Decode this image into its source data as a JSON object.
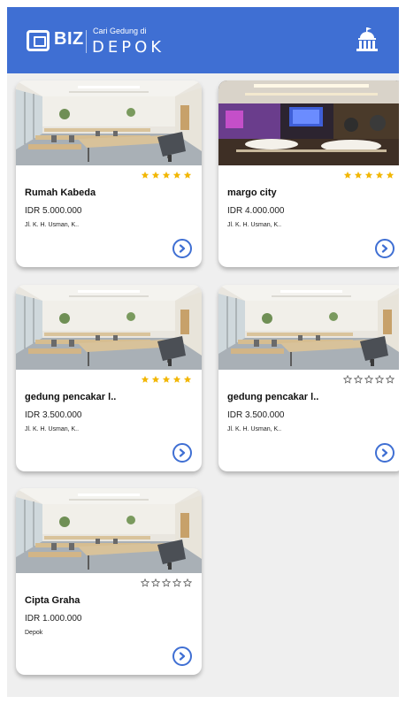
{
  "header": {
    "logo_text": "BIZ",
    "tagline": "Cari Gedung di",
    "city": "DEPOK",
    "building_icon": "building-icon"
  },
  "colors": {
    "primary": "#3f6fd3",
    "star_filled": "#f2b705",
    "star_empty": "#666666",
    "background": "#efefef"
  },
  "venues": [
    {
      "name": "Rumah Kabeda",
      "price": "IDR 5.000.000",
      "address": "Jl. K. H. Usman, K..",
      "rating": 5,
      "photo": "meeting-room"
    },
    {
      "name": "margo city",
      "price": "IDR 4.000.000",
      "address": "Jl. K. H. Usman, K..",
      "rating": 5,
      "photo": "ballroom"
    },
    {
      "name": "gedung pencakar l..",
      "price": "IDR 3.500.000",
      "address": "Jl. K. H. Usman, K..",
      "rating": 5,
      "photo": "meeting-room"
    },
    {
      "name": "gedung pencakar l..",
      "price": "IDR 3.500.000",
      "address": "Jl. K. H. Usman, K..",
      "rating": 0,
      "photo": "meeting-room"
    },
    {
      "name": "Cipta Graha",
      "price": "IDR 1.000.000",
      "address": "Depok",
      "rating": 0,
      "photo": "meeting-room"
    }
  ]
}
